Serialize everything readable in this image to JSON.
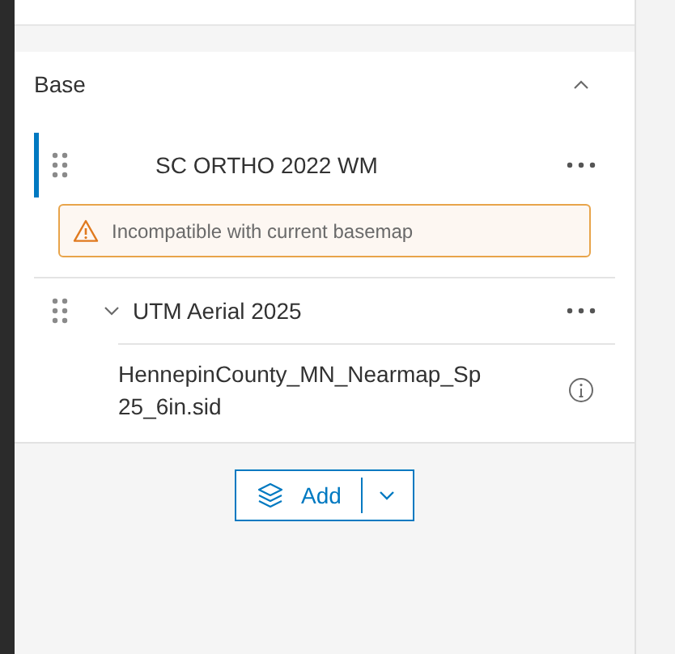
{
  "group": {
    "title": "Base",
    "expanded": true
  },
  "layers": [
    {
      "kind": "layer",
      "name": "SC ORTHO 2022 WM",
      "selected": true,
      "warning": "Incompatible with current basemap"
    },
    {
      "kind": "group",
      "name": "UTM Aerial 2025",
      "selected": false,
      "expanded": true,
      "children": [
        {
          "name": "HennepinCounty_MN_Nearmap_Sp25_6in.sid"
        }
      ]
    }
  ],
  "add_button": {
    "label": "Add"
  }
}
